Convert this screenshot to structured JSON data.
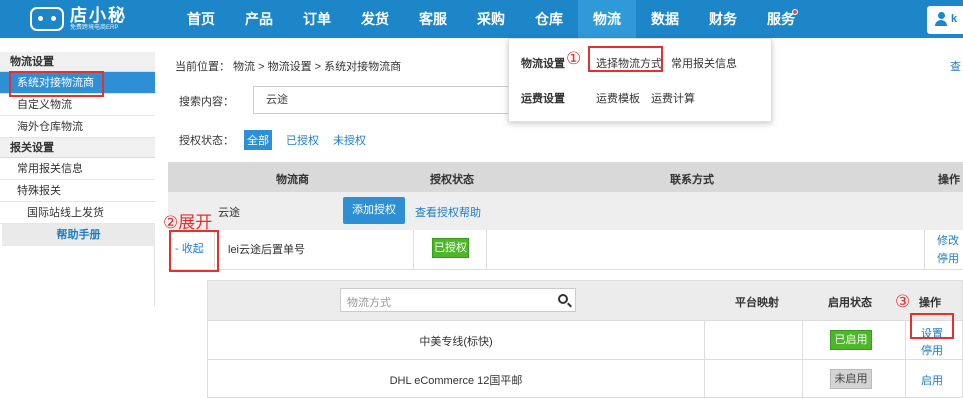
{
  "brand": {
    "name": "店小秘",
    "tagline": "免费跨境电商ERP"
  },
  "nav": {
    "items": [
      "首页",
      "产品",
      "订单",
      "发货",
      "客服",
      "采购",
      "仓库",
      "物流",
      "数据",
      "财务",
      "服务"
    ],
    "active_index": 7
  },
  "user": {
    "initial": "k"
  },
  "sidebar": {
    "group1": "物流设置",
    "item_system": "系统对接物流商",
    "item_custom": "自定义物流",
    "item_overseas": "海外仓库物流",
    "group2": "报关设置",
    "item_customs_info": "常用报关信息",
    "item_special": "特殊报关",
    "item_intl": "国际站线上发货",
    "help": "帮助手册"
  },
  "main": {
    "breadcrumb": "当前位置： 物流 > 物流设置 > 系统对接物流商",
    "query_link": "查",
    "search_label": "搜索内容：",
    "search_value": "云途",
    "auth_label": "授权状态：",
    "auth_all": "全部",
    "auth_yes": "已授权",
    "auth_no": "未授权",
    "col_provider": "物流商",
    "col_auth": "授权状态",
    "col_contact": "联系方式",
    "col_ops": "操作",
    "provider_name": "云途",
    "add_auth": "添加授权",
    "view_help": "查看授权帮助",
    "collapse": "- 收起",
    "detail_name": "lei云途后置单号",
    "detail_status": "已授权",
    "op_edit": "修改",
    "op_disable": "停用"
  },
  "sub": {
    "search_placeholder": "物流方式",
    "col_platform": "平台映射",
    "col_status": "启用状态",
    "col_ops": "操作",
    "rows": [
      {
        "name": "中美专线(标快)",
        "status": "已启用",
        "op1": "设置",
        "op2": "停用"
      },
      {
        "name": "DHL eCommerce 12国平邮",
        "status": "未启用",
        "op1": "启用"
      }
    ]
  },
  "dropdown": {
    "label1": "物流设置",
    "link_select": "选择物流方式",
    "link_customs": "常用报关信息",
    "label2": "运费设置",
    "link_template": "运费模板",
    "link_calc": "运费计算"
  },
  "annotations": {
    "a1": "①",
    "a2": "②展开",
    "a3": "③"
  },
  "colors": {
    "nav_bg": "#1c86c9",
    "accent": "#2f8fd5",
    "link": "#1c7dc6",
    "green": "#4cb728",
    "marker": "#e53030"
  }
}
